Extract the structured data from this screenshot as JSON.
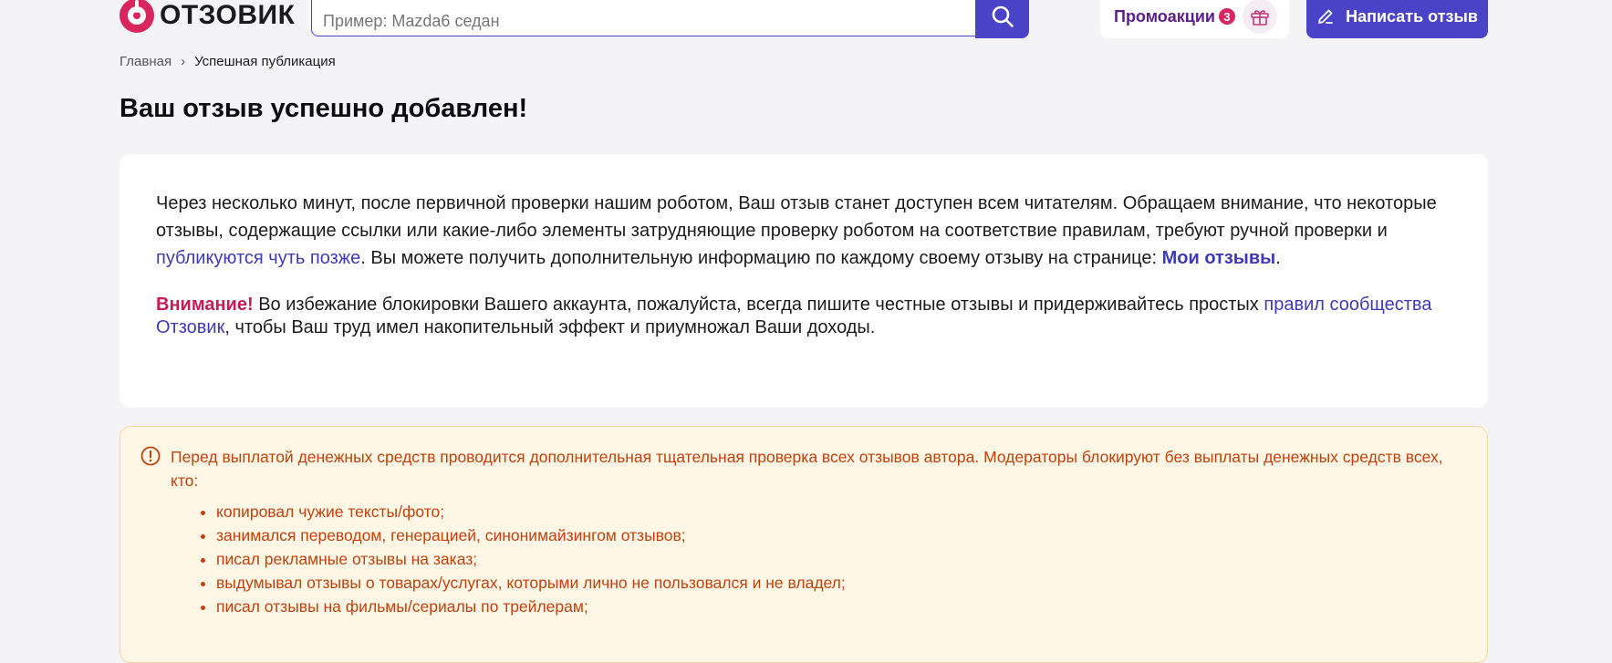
{
  "header": {
    "logo_text": "ОТЗОВИК",
    "search_placeholder": "Пример: Mazda6 седан",
    "promo_label": "Промоакции",
    "promo_count": "3",
    "write_review_label": "Написать отзыв"
  },
  "breadcrumb": {
    "home": "Главная",
    "separator": "›",
    "current": "Успешная публикация"
  },
  "page_title": "Ваш отзыв успешно добавлен!",
  "card": {
    "para1_text1": "Через несколько минут, после первичной проверки нашим роботом, Ваш отзыв станет доступен всем читателям. Обращаем внимание, что некоторые отзывы, содержащие ссылки или какие-либо элементы затрудняющие проверку роботом на соответствие правилам, требуют ручной проверки и ",
    "para1_link1": "публикуются чуть позже",
    "para1_text2": ". Вы можете получить дополнительную информацию по каждому своему отзыву на странице: ",
    "para1_link2": "Мои отзывы",
    "para1_text3": ".",
    "warn_label": "Внимание!",
    "warn_text1": " Во избежание блокировки Вашего аккаунта, пожалуйста, всегда пишите честные отзывы и придерживайтесь простых ",
    "warn_link": "правил сообщества Отзовик",
    "warn_text2": ", чтобы Ваш труд имел накопительный эффект и приумножал Ваши доходы."
  },
  "notice": {
    "text": "Перед выплатой денежных средств проводится дополнительная тщательная проверка всех отзывов автора. Модераторы блокируют без выплаты денежных средств всех, кто:",
    "items": [
      "копировал чужие тексты/фото;",
      "занимался переводом, генерацией, синонимайзингом отзывов;",
      "писал рекламные отзывы на заказ;",
      "выдумывал отзывы о товарах/услугах, которыми лично не пользовался и не владел;",
      "писал отзывы на фильмы/сериалы по трейлерам;"
    ]
  },
  "colors": {
    "accent": "#4a43c8",
    "brand": "#d8275f",
    "warning": "#c2410c",
    "background": "#f4f4f6"
  }
}
